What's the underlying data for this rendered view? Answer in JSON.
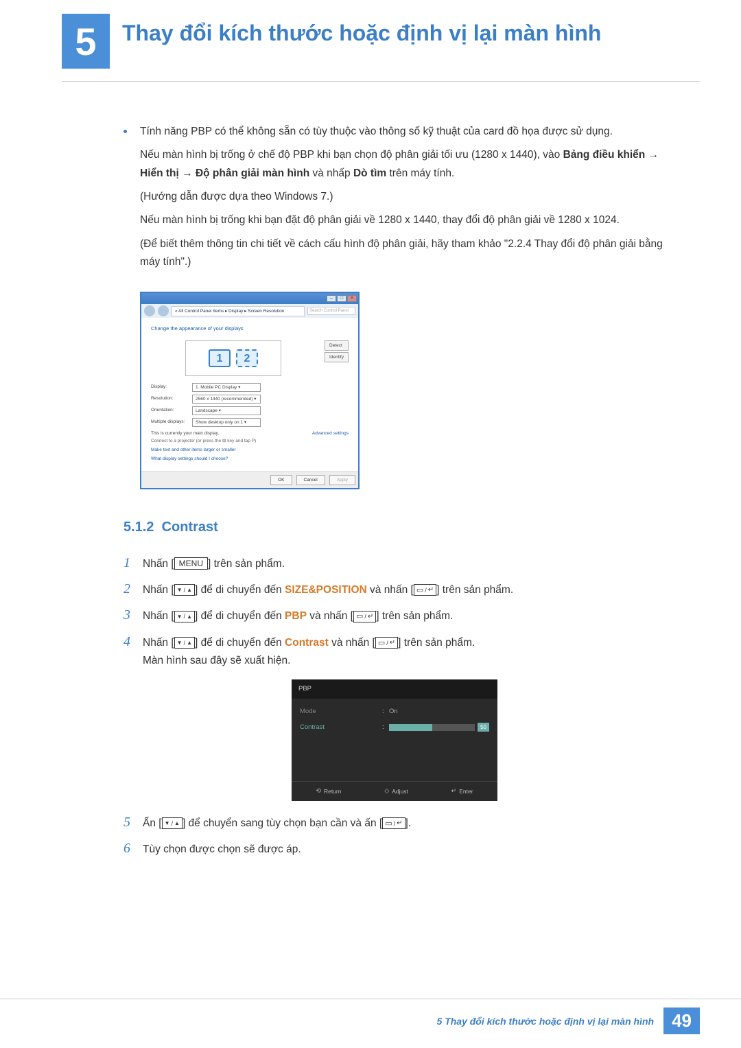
{
  "chapter": {
    "number": "5",
    "title": "Thay đổi kích thước hoặc định vị lại màn hình"
  },
  "bullet": "Tính năng PBP có thể không sẵn có tùy thuộc vào thông số kỹ thuật của card đồ họa được sử dụng.",
  "p1_a": "Nếu màn hình bị trống ở chế độ PBP khi bạn chọn độ phân giải tối ưu (1280 x 1440), vào ",
  "p1_b": "Bảng điều khiển",
  "p1_c": "Hiển thị",
  "p1_d": "Độ phân giải màn hình",
  "p1_e": " và nhấp ",
  "p1_f": "Dò tìm",
  "p1_g": " trên máy tính.",
  "p2": "(Hướng dẫn được dựa theo Windows 7.)",
  "p3": "Nếu màn hình bị trống khi bạn đặt độ phân giải về 1280 x 1440, thay đổi độ phân giải về 1280 x 1024.",
  "p4": "(Để biết thêm thông tin chi tiết về cách cấu hình độ phân giải, hãy tham khảo \"2.2.4    Thay đổi độ phân giải bằng máy tính\".)",
  "winshot": {
    "breadcrumb": "« All Control Panel Items  ▸  Display  ▸  Screen Resolution",
    "search": "Search Control Panel",
    "title": "Change the appearance of your displays",
    "detect": "Detect",
    "identify": "Identify",
    "m1": "1",
    "m2": "2",
    "rows": {
      "display_l": "Display:",
      "display_v": "1. Mobile PC Display ▾",
      "res_l": "Resolution:",
      "res_v": "2560 x 1440 (recommended) ▾",
      "orient_l": "Orientation:",
      "orient_v": "Landscape ▾",
      "multi_l": "Multiple displays:",
      "multi_v": "Show desktop only on 1 ▾"
    },
    "main_note": "This is currently your main display.",
    "adv": "Advanced settings",
    "proj": "Connect to a projector (or press the ⊞ key and tap P)",
    "link1": "Make text and other items larger or smaller",
    "link2": "What display settings should I choose?",
    "ok": "OK",
    "cancel": "Cancel",
    "apply": "Apply"
  },
  "subsection": {
    "number": "5.1.2",
    "title": "Contrast"
  },
  "steps": {
    "s1_a": "Nhấn [",
    "s1_menu": "MENU",
    "s1_b": "] trên sản phẩm.",
    "s2_a": "Nhấn [",
    "s2_b": "] để di chuyển đến ",
    "s2_c": "SIZE&POSITION",
    "s2_d": " và nhấn [",
    "s2_e": "] trên sản phẩm.",
    "s3_a": "Nhấn [",
    "s3_b": "] để di chuyển đến ",
    "s3_c": "PBP",
    "s3_d": " và nhấn [",
    "s3_e": "] trên sản phẩm.",
    "s4_a": "Nhấn [",
    "s4_b": "] để di chuyển đến ",
    "s4_c": "Contrast",
    "s4_d": " và nhấn [",
    "s4_e": "] trên sản phẩm.",
    "s4_f": "Màn hình sau đây sẽ xuất hiện.",
    "s5_a": "Ấn [",
    "s5_b": "] để chuyển sang tùy chọn bạn cần và ấn [",
    "s5_c": "].",
    "s6": "Tùy chọn được chọn sẽ được áp."
  },
  "osd": {
    "title": "PBP",
    "mode_l": "Mode",
    "mode_v": "On",
    "contrast_l": "Contrast",
    "contrast_v": "50",
    "return": "Return",
    "adjust": "Adjust",
    "enter": "Enter"
  },
  "footer": {
    "text": "5 Thay đổi kích thước hoặc định vị lại màn hình",
    "page": "49"
  }
}
